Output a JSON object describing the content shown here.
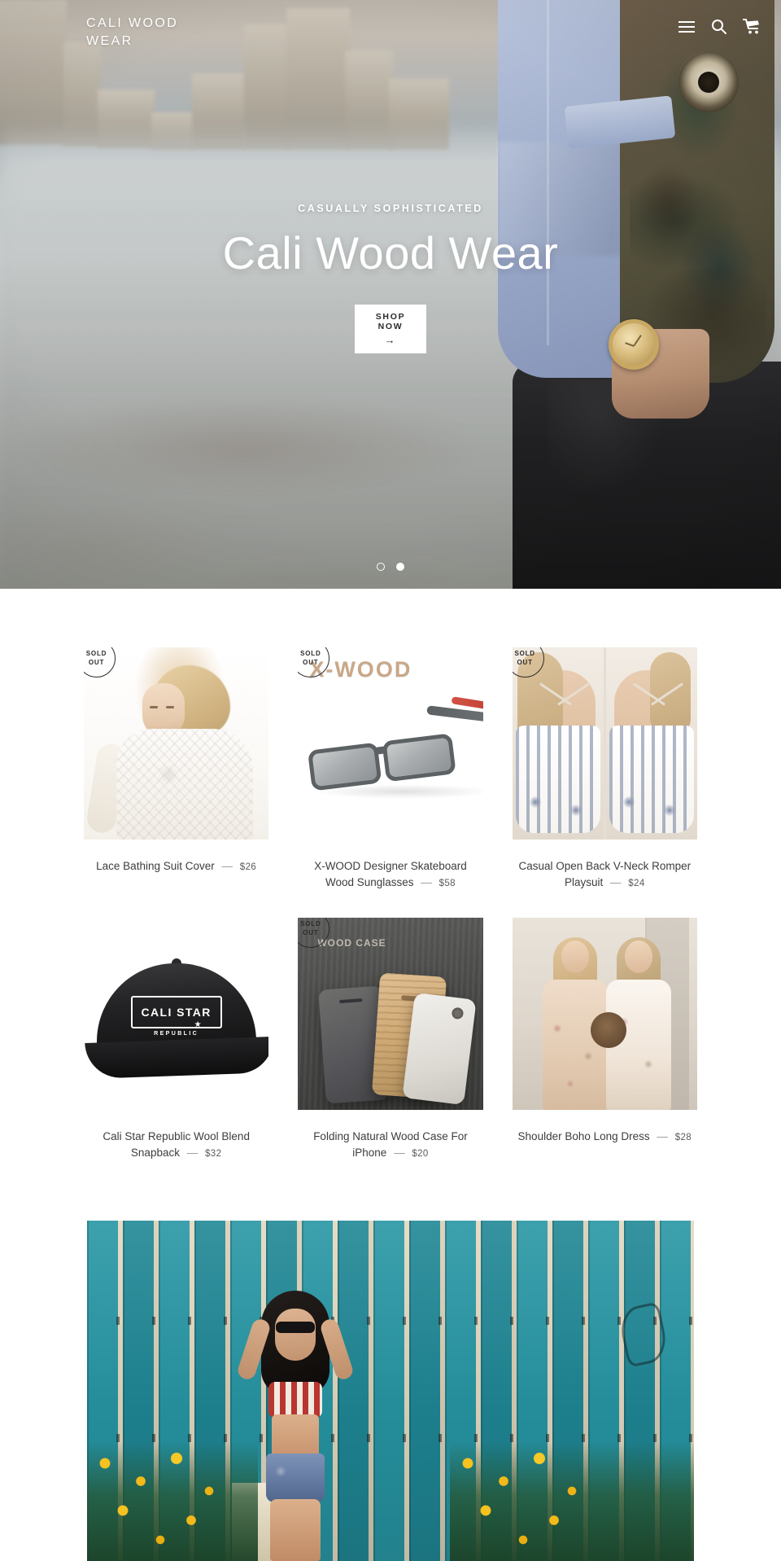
{
  "header": {
    "logo": "CALI WOOD WEAR",
    "icons": [
      {
        "name": "menu-icon",
        "label": "Menu"
      },
      {
        "name": "search-icon",
        "label": "Search"
      },
      {
        "name": "cart-icon",
        "label": "Cart"
      }
    ]
  },
  "hero": {
    "subtitle": "CASUALLY SOPHISTICATED",
    "title": "Cali Wood Wear",
    "button_label": "SHOP NOW",
    "button_arrow": "→",
    "slides_total": 2,
    "active_slide": 2
  },
  "products": [
    {
      "title": "Lace Bathing Suit Cover",
      "separator": "—",
      "price": "$26",
      "sold_out": true,
      "badge_line1": "SOLD",
      "badge_line2": "OUT"
    },
    {
      "title": "X-WOOD Designer Skateboard Wood Sunglasses",
      "separator": "—",
      "price": "$58",
      "sold_out": true,
      "badge_line1": "SOLD",
      "badge_line2": "OUT",
      "image_text": "X-WOOD"
    },
    {
      "title": "Casual Open Back V-Neck Romper Playsuit",
      "separator": "—",
      "price": "$24",
      "sold_out": true,
      "badge_line1": "SOLD",
      "badge_line2": "OUT"
    },
    {
      "title": "Cali Star Republic Wool Blend Snapback",
      "separator": "—",
      "price": "$32",
      "sold_out": false,
      "image_text": "CALI STAR",
      "image_subtext": "REPUBLIC"
    },
    {
      "title": "Folding Natural Wood Case For iPhone",
      "separator": "—",
      "price": "$20",
      "sold_out": true,
      "badge_line1": "SOLD",
      "badge_line2": "OUT",
      "image_text": "WOOD CASE"
    },
    {
      "title": "Shoulder Boho Long Dress",
      "separator": "—",
      "price": "$28",
      "sold_out": false
    }
  ],
  "colors": {
    "text": "#3d3d3d",
    "muted": "#9a9a9a",
    "accent": "#ffffff",
    "badge_border": "#2b2b2b"
  }
}
